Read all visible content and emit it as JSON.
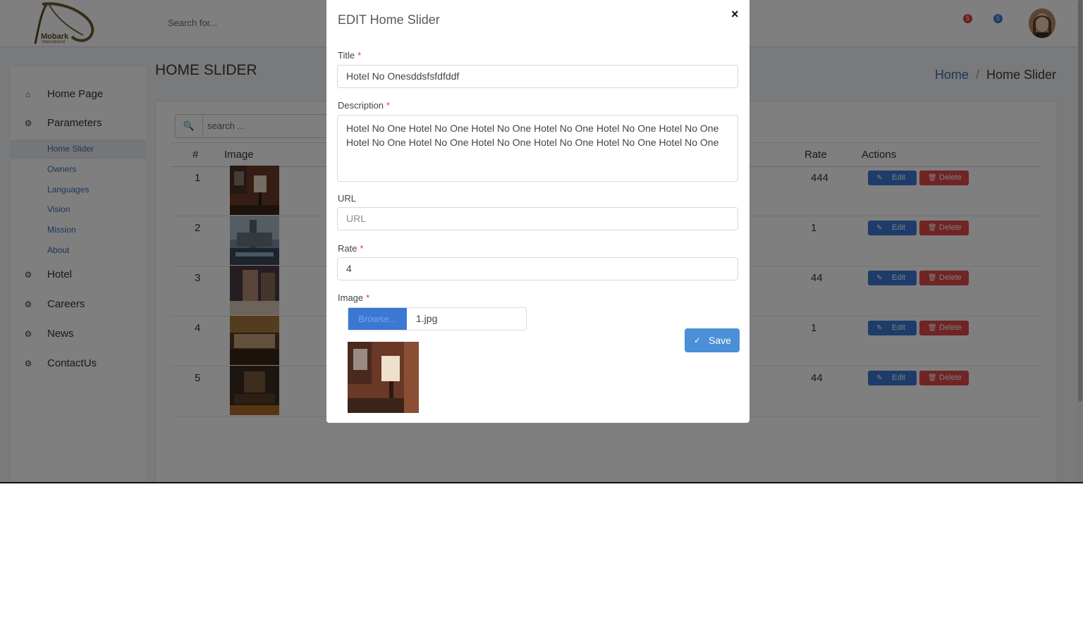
{
  "header": {
    "logo_text": "Mobark",
    "logo_sub": "International",
    "search_placeholder": "Search for...",
    "notifications_count": "5",
    "messages_count": "5"
  },
  "sidebar": {
    "items": [
      {
        "label": "Home Page",
        "icon": "home-icon"
      },
      {
        "label": "Parameters",
        "icon": "gear-icon"
      }
    ],
    "sub_items": [
      {
        "label": "Home Slider",
        "active": true
      },
      {
        "label": "Owners"
      },
      {
        "label": "Languages"
      },
      {
        "label": "Vision"
      },
      {
        "label": "Mission"
      },
      {
        "label": "About"
      }
    ],
    "more_items": [
      {
        "label": "Hotel",
        "icon": "gear-icon"
      },
      {
        "label": "Careers",
        "icon": "gear-icon"
      },
      {
        "label": "News",
        "icon": "gear-icon"
      },
      {
        "label": "ContactUs",
        "icon": "gear-icon"
      }
    ]
  },
  "page": {
    "title": "HOME SLIDER",
    "breadcrumb": {
      "home": "Home",
      "separator": "/",
      "current": "Home Slider"
    }
  },
  "table": {
    "search_placeholder": "search ...",
    "columns": {
      "num": "#",
      "image": "Image",
      "rate": "Rate",
      "actions": "Actions"
    },
    "rows": [
      {
        "num": "1",
        "rate": "444"
      },
      {
        "num": "2",
        "rate": "1"
      },
      {
        "num": "3",
        "rate": "44"
      },
      {
        "num": "4",
        "rate": "1"
      },
      {
        "num": "5",
        "rate": "44"
      }
    ],
    "edit_label": "Edit",
    "delete_label": "Delete"
  },
  "modal": {
    "title": "EDIT Home Slider",
    "close": "×",
    "title_label": "Title",
    "title_value": "Hotel No Onesddsfsfdfddf",
    "description_label": "Description",
    "description_value": "Hotel No One Hotel No One Hotel No One Hotel No One Hotel No One Hotel No One Hotel No One Hotel No One Hotel No One Hotel No One Hotel No One Hotel No One",
    "url_label": "URL",
    "url_placeholder": "URL",
    "rate_label": "Rate",
    "rate_value": "4",
    "image_label": "Image",
    "browse_label": "Browse...",
    "file_name": "1.jpg",
    "save_label": "Save",
    "required_mark": "*"
  },
  "colors": {
    "primary": "#3b78d4",
    "danger": "#e14848",
    "link": "#3d6db5",
    "required": "#e03a3a"
  }
}
